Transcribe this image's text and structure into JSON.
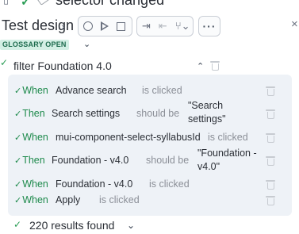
{
  "header": {
    "title": "selector changed"
  },
  "design": {
    "title": "Test design"
  },
  "glossary": {
    "label": "GLOSSARY OPEN"
  },
  "filter": {
    "label": "filter Foundation 4.0"
  },
  "steps": [
    {
      "keyword": "When",
      "object": "Advance search",
      "verb": "is clicked",
      "value": ""
    },
    {
      "keyword": "Then",
      "object": "Search settings",
      "verb": "should be",
      "value": "\"Search settings\""
    },
    {
      "keyword": "When",
      "object": "mui-component-select-syllabusId",
      "verb": "is clicked",
      "value": ""
    },
    {
      "keyword": "Then",
      "object": "Foundation - v4.0",
      "verb": "should be",
      "value": "\"Foundation - v4.0\""
    },
    {
      "keyword": "When",
      "object": "Foundation - v4.0",
      "verb": "is clicked",
      "value": ""
    },
    {
      "keyword": "When",
      "object": "Apply",
      "verb": "is clicked",
      "value": ""
    }
  ],
  "results": {
    "label": "220 results found"
  },
  "icons": {
    "page": "page-icon",
    "check": "check-icon",
    "eraser": "eraser-icon",
    "record": "record-icon",
    "play": "play-icon",
    "stop": "stop-icon",
    "step-into": "step-into-icon",
    "step-back": "step-back-icon",
    "branch": "branch-icon",
    "more": "more-icon",
    "close": "close-icon",
    "trash": "trash-icon"
  },
  "colors": {
    "accent_green": "#1e8a4c",
    "badge_bg": "#d3efe4",
    "badge_text": "#1d6b4d",
    "panel_bg": "#eef2f7"
  }
}
